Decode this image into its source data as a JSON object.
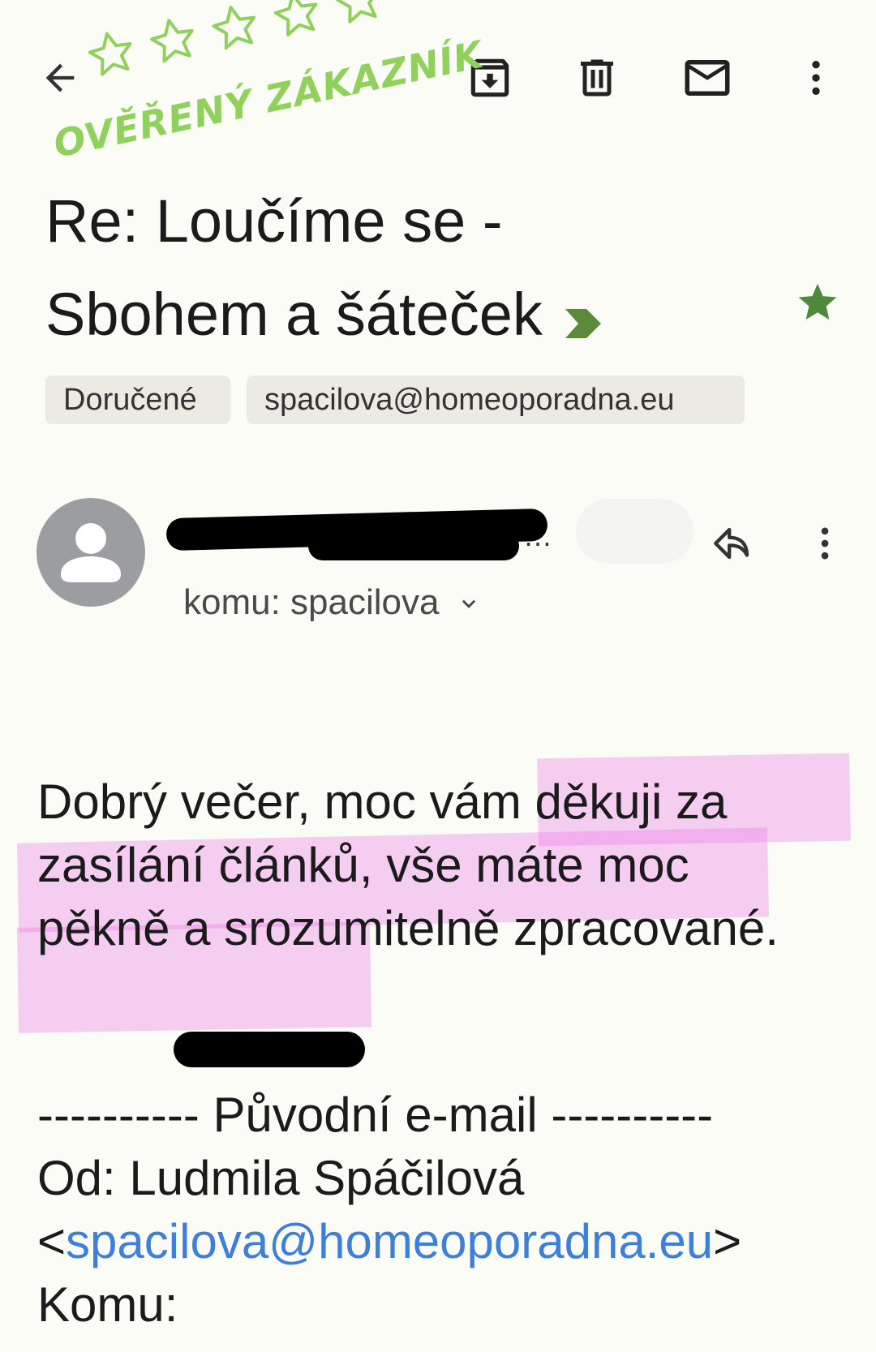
{
  "toolbar": {
    "back_icon": "arrow-left-icon",
    "archive_icon": "archive-icon",
    "delete_icon": "trash-icon",
    "mark_unread_icon": "envelope-icon",
    "more_icon": "more-vertical-icon"
  },
  "stamp": {
    "text": "OVĚŘENÝ ZÁKAZNÍK",
    "stars": 5,
    "color": "#8fd15c"
  },
  "email": {
    "subject_line1": "Re: Loučíme se -",
    "subject_line2": "Sbohem a šáteček",
    "importance_color": "#5c8a3a",
    "starred": true,
    "star_color": "#4f8a3c",
    "labels": [
      "Doručené",
      "spacilova@homeoporadna.eu"
    ],
    "recipient": "komu: spacilova",
    "body": "Dobrý večer, moc vám děkuji za zasílání článků, vše máte moc pěkně a srozumitelně zpracované.",
    "quote_header": "---------- Původní e-mail ----------",
    "from_label": "Od: Ludmila Spáčilová",
    "from_email": "spacilova@homeoporadna.eu",
    "to_label": "Komu:"
  },
  "colors": {
    "background": "#fcfcf6",
    "highlight": "#ea82e8",
    "link": "#3d7fd9"
  }
}
